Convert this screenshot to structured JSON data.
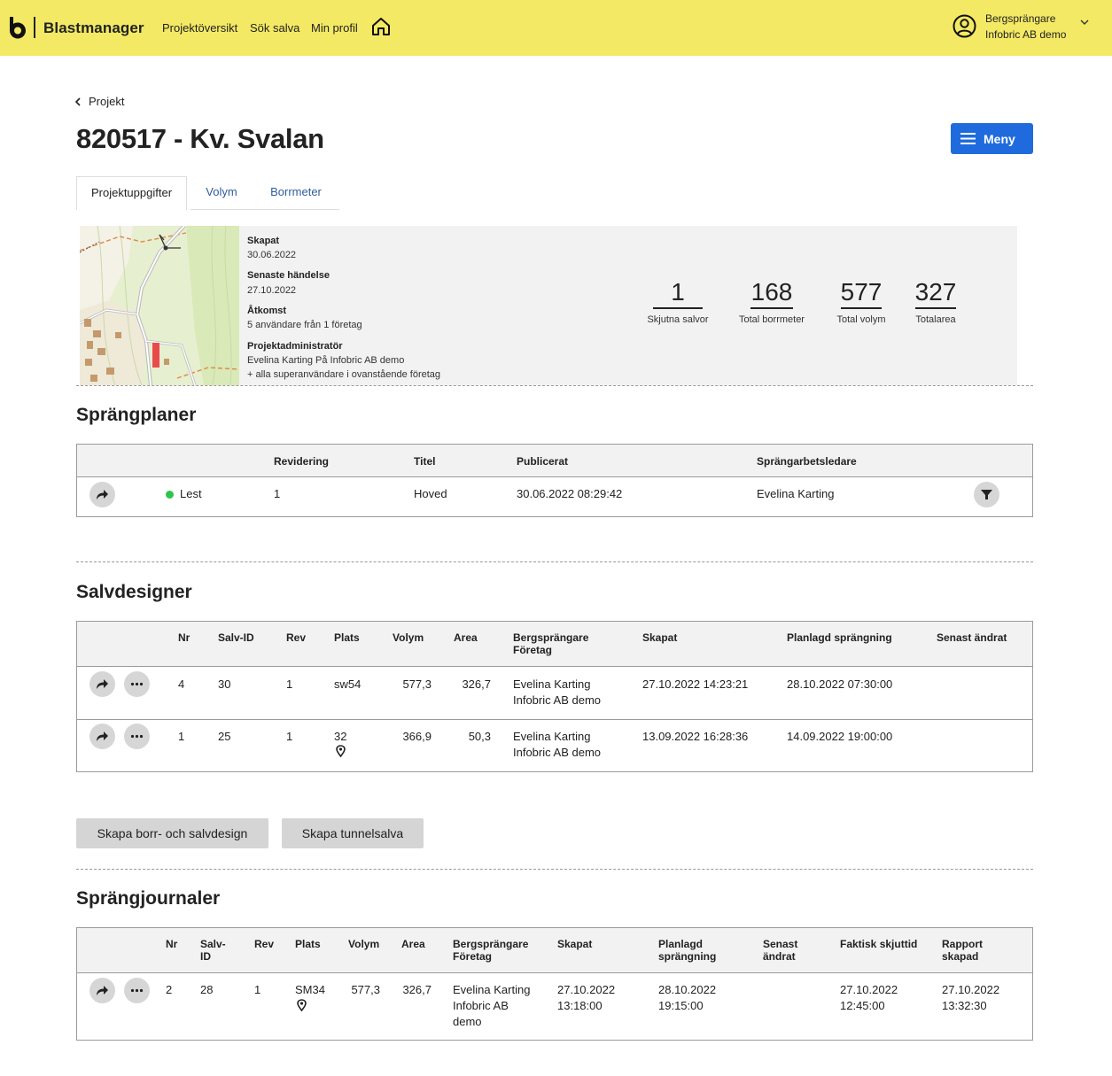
{
  "header": {
    "brand": "Blastmanager",
    "nav": [
      "Projektöversikt",
      "Sök salva",
      "Min profil"
    ],
    "user_role": "Bergsprängare",
    "user_company": "Infobric AB demo",
    "bg_color": "#f3e964"
  },
  "breadcrumb": "Projekt",
  "title": "820517 - Kv. Svalan",
  "menu_button": "Meny",
  "tabs": [
    "Projektuppgifter",
    "Volym",
    "Borrmeter"
  ],
  "info": {
    "created_label": "Skapat",
    "created_value": "30.06.2022",
    "last_event_label": "Senaste händelse",
    "last_event_value": "27.10.2022",
    "access_label": "Åtkomst",
    "access_value": "5 användare från 1 företag",
    "admin_label": "Projektadministratör",
    "admin_value": "Evelina Karting På Infobric AB demo",
    "admin_extra": "+ alla superanvändare i ovanstående företag"
  },
  "stats": [
    {
      "value": "1",
      "label": "Skjutna salvor"
    },
    {
      "value": "168",
      "label": "Total borrmeter"
    },
    {
      "value": "577",
      "label": "Total volym"
    },
    {
      "value": "327",
      "label": "Totalarea"
    }
  ],
  "sprangplaner": {
    "title": "Sprängplaner",
    "headers": [
      "Revidering",
      "Titel",
      "Publicerat",
      "Sprängarbetsledare"
    ],
    "rows": [
      {
        "status": "Lest",
        "revidering": "1",
        "titel": "Hoved",
        "publicerat": "30.06.2022 08:29:42",
        "ledare": "Evelina Karting"
      }
    ]
  },
  "salvdesigner": {
    "title": "Salvdesigner",
    "headers": {
      "nr": "Nr",
      "salv_id": "Salv-ID",
      "rev": "Rev",
      "plats": "Plats",
      "volym": "Volym",
      "area": "Area",
      "bergs_1": "Bergsprängare",
      "bergs_2": "Företag",
      "skapat": "Skapat",
      "planlagd": "Planlagd sprängning",
      "senast": "Senast ändrat"
    },
    "rows": [
      {
        "nr": "4",
        "salv_id": "30",
        "rev": "1",
        "plats": "sw54",
        "volym": "577,3",
        "area": "326,7",
        "namn": "Evelina Karting",
        "foretag": "Infobric AB demo",
        "skapat": "27.10.2022 14:23:21",
        "planlagd": "28.10.2022 07:30:00",
        "senast": ""
      },
      {
        "nr": "1",
        "salv_id": "25",
        "rev": "1",
        "plats": "32",
        "volym": "366,9",
        "area": "50,3",
        "namn": "Evelina Karting",
        "foretag": "Infobric AB demo",
        "skapat": "13.09.2022 16:28:36",
        "planlagd": "14.09.2022 19:00:00",
        "senast": ""
      }
    ]
  },
  "buttons": {
    "create_design": "Skapa borr- och salvdesign",
    "create_tunnel": "Skapa tunnelsalva"
  },
  "sprangjournaler": {
    "title": "Sprängjournaler",
    "headers": {
      "nr": "Nr",
      "salv_1": "Salv-",
      "salv_2": "ID",
      "rev": "Rev",
      "plats": "Plats",
      "volym": "Volym",
      "area": "Area",
      "bergs_1": "Bergsprängare",
      "bergs_2": "Företag",
      "skapat": "Skapat",
      "planlagd_1": "Planlagd",
      "planlagd_2": "sprängning",
      "senast_1": "Senast",
      "senast_2": "ändrat",
      "faktisk": "Faktisk skjuttid",
      "rapport_1": "Rapport",
      "rapport_2": "skapad"
    },
    "rows": [
      {
        "nr": "2",
        "salv_id": "28",
        "rev": "1",
        "plats": "SM34",
        "volym": "577,3",
        "area": "326,7",
        "namn": "Evelina Karting",
        "foretag_1": "Infobric AB",
        "foretag_2": "demo",
        "skapat_1": "27.10.2022",
        "skapat_2": "13:18:00",
        "planlagd_1": "28.10.2022",
        "planlagd_2": "19:15:00",
        "faktisk_1": "27.10.2022",
        "faktisk_2": "12:45:00",
        "rapport_1": "27.10.2022",
        "rapport_2": "13:32:30"
      }
    ]
  }
}
